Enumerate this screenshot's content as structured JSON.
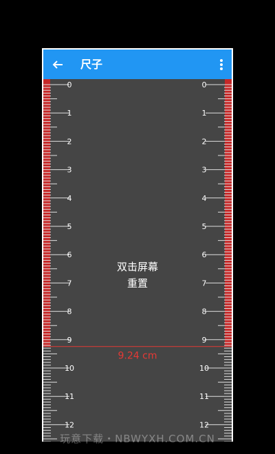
{
  "app": {
    "title": "尺子",
    "back_icon": "arrow-left-icon",
    "menu_icon": "more-vert-icon"
  },
  "ruler": {
    "labels": [
      "0",
      "1",
      "2",
      "3",
      "4",
      "5",
      "6",
      "7",
      "8",
      "9",
      "10",
      "11",
      "12"
    ],
    "measurement": "9.24 cm",
    "measurement_value_cm": 9.24,
    "unit": "cm",
    "colors": {
      "accent": "#2196f3",
      "measured_fill": "#c62828",
      "measure_line": "#e53935",
      "background": "#454545",
      "tick": "#e0e0e0"
    }
  },
  "hint": {
    "line1": "双击屏幕",
    "line2": "重置"
  },
  "watermark": "玩意下载・NBWYXH.COM.CN"
}
